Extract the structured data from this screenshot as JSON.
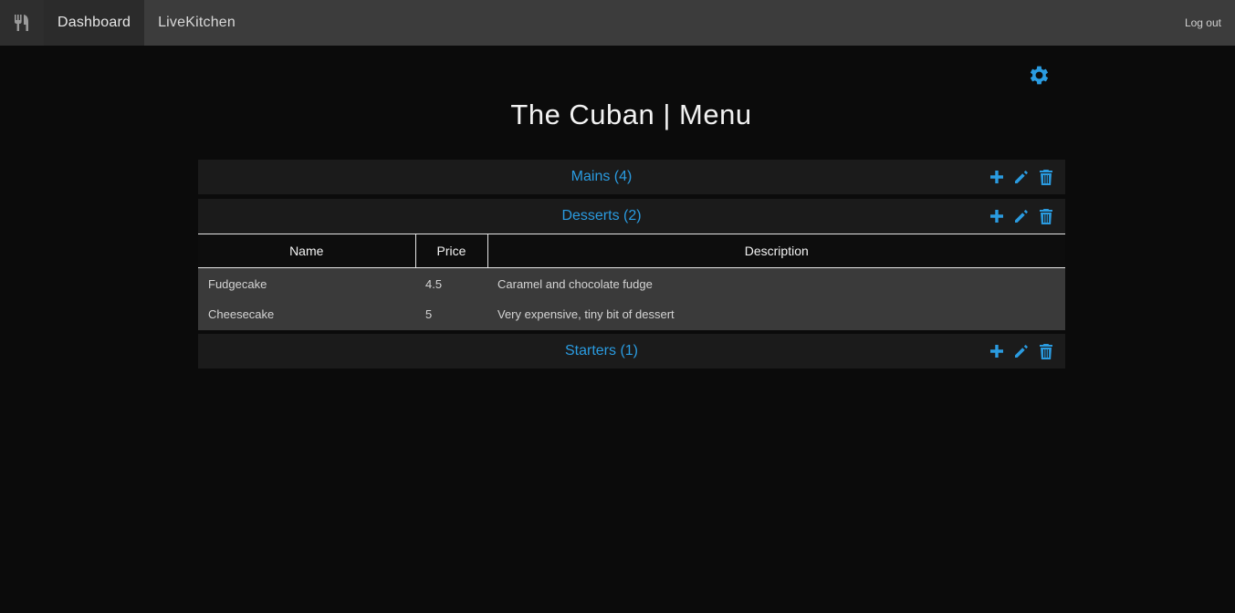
{
  "nav": {
    "brand_icon": "fork-knife-icon",
    "items": [
      {
        "label": "Dashboard",
        "active": true
      },
      {
        "label": "LiveKitchen",
        "active": false
      }
    ],
    "logout_label": "Log out"
  },
  "settings_icon": "gear-icon",
  "page_title": "The Cuban | Menu",
  "accent_color": "#2a9be0",
  "sections": [
    {
      "title": "Mains (4)",
      "expanded": false
    },
    {
      "title": "Desserts (2)",
      "expanded": true
    },
    {
      "title": "Starters (1)",
      "expanded": false
    }
  ],
  "section_actions": [
    "plus-icon",
    "pencil-icon",
    "trash-icon"
  ],
  "table": {
    "columns": [
      "Name",
      "Price",
      "Description"
    ],
    "rows": [
      {
        "name": "Fudgecake",
        "price": "4.5",
        "description": "Caramel and chocolate fudge"
      },
      {
        "name": "Cheesecake",
        "price": "5",
        "description": "Very expensive, tiny bit of dessert"
      }
    ]
  }
}
